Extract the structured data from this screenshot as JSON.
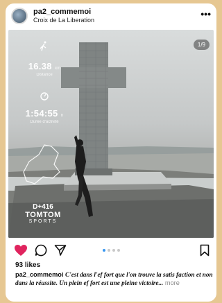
{
  "post": {
    "username": "pa2_commemoi",
    "location": "Croix de La Liberation",
    "more_icon": "more-horizontal-icon",
    "image_counter": "1/9",
    "stats": {
      "distance_value": "16.38",
      "distance_unit": "km",
      "distance_label": "Distance",
      "duration_value": "1:54:55",
      "duration_unit": "h",
      "duration_label": "Durée d'activité",
      "elevation": "D+416",
      "brand": "TOMTOM",
      "brand_sub": "SPORTS"
    },
    "carousel": {
      "dots": 4,
      "active_index": 0
    },
    "likes": "93 likes",
    "caption": {
      "username": "pa2_commemoi",
      "text": "C'est dans l'ef fort que l'on trouve la satis faction et non dans la réussite. Un plein ef fort est une pleine victoire...",
      "more": "more"
    },
    "colors": {
      "like": "#e0245e",
      "accent": "#3897f0",
      "background": "#e6c792"
    }
  }
}
